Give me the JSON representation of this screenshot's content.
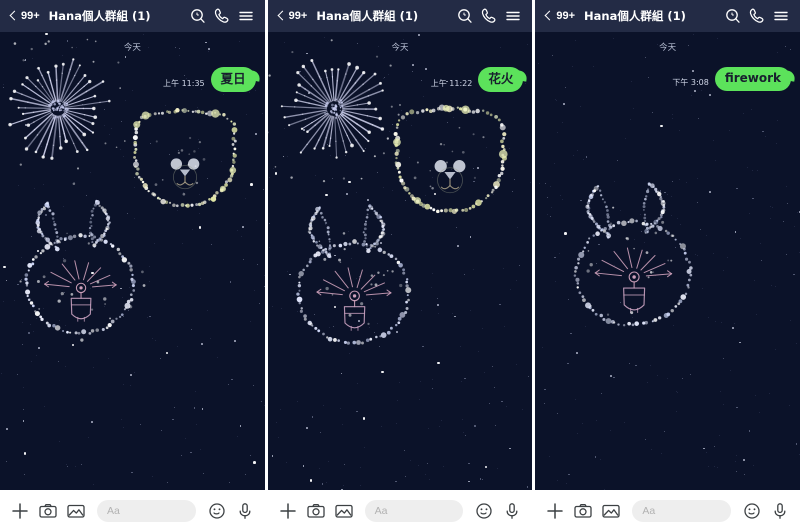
{
  "meta": {
    "app": "LINE",
    "screens": 3,
    "colors": {
      "chat_bg": "#0b1229",
      "header_bg": "#232b45",
      "bubble_green": "#5ce25b",
      "bubble_text": "#18202e",
      "footer_bg": "#ffffff",
      "input_bg": "#eeeeee"
    }
  },
  "header": {
    "back_badge": "99+",
    "title": "Hana個人群組 (1)",
    "icons": [
      "search-icon",
      "call-icon",
      "menu-icon"
    ]
  },
  "footer": {
    "placeholder": "Aa",
    "left_icons": [
      "plus-icon",
      "camera-icon",
      "photo-icon"
    ],
    "right_icons": [
      "emoji-icon",
      "microphone-icon"
    ]
  },
  "panels": [
    {
      "id": "panel-1",
      "date_label": "今天",
      "message": {
        "time": "上午 11:35",
        "text": "夏日",
        "keyword_latin": false
      },
      "effect": "summer-fireworks"
    },
    {
      "id": "panel-2",
      "date_label": "今天",
      "message": {
        "time": "上午 11:22",
        "text": "花火",
        "keyword_latin": false
      },
      "effect": "hanabi-fireworks"
    },
    {
      "id": "panel-3",
      "date_label": "今天",
      "message": {
        "time": "下午 3:08",
        "text": "firework",
        "keyword_latin": true
      },
      "effect": "firework-english"
    }
  ]
}
